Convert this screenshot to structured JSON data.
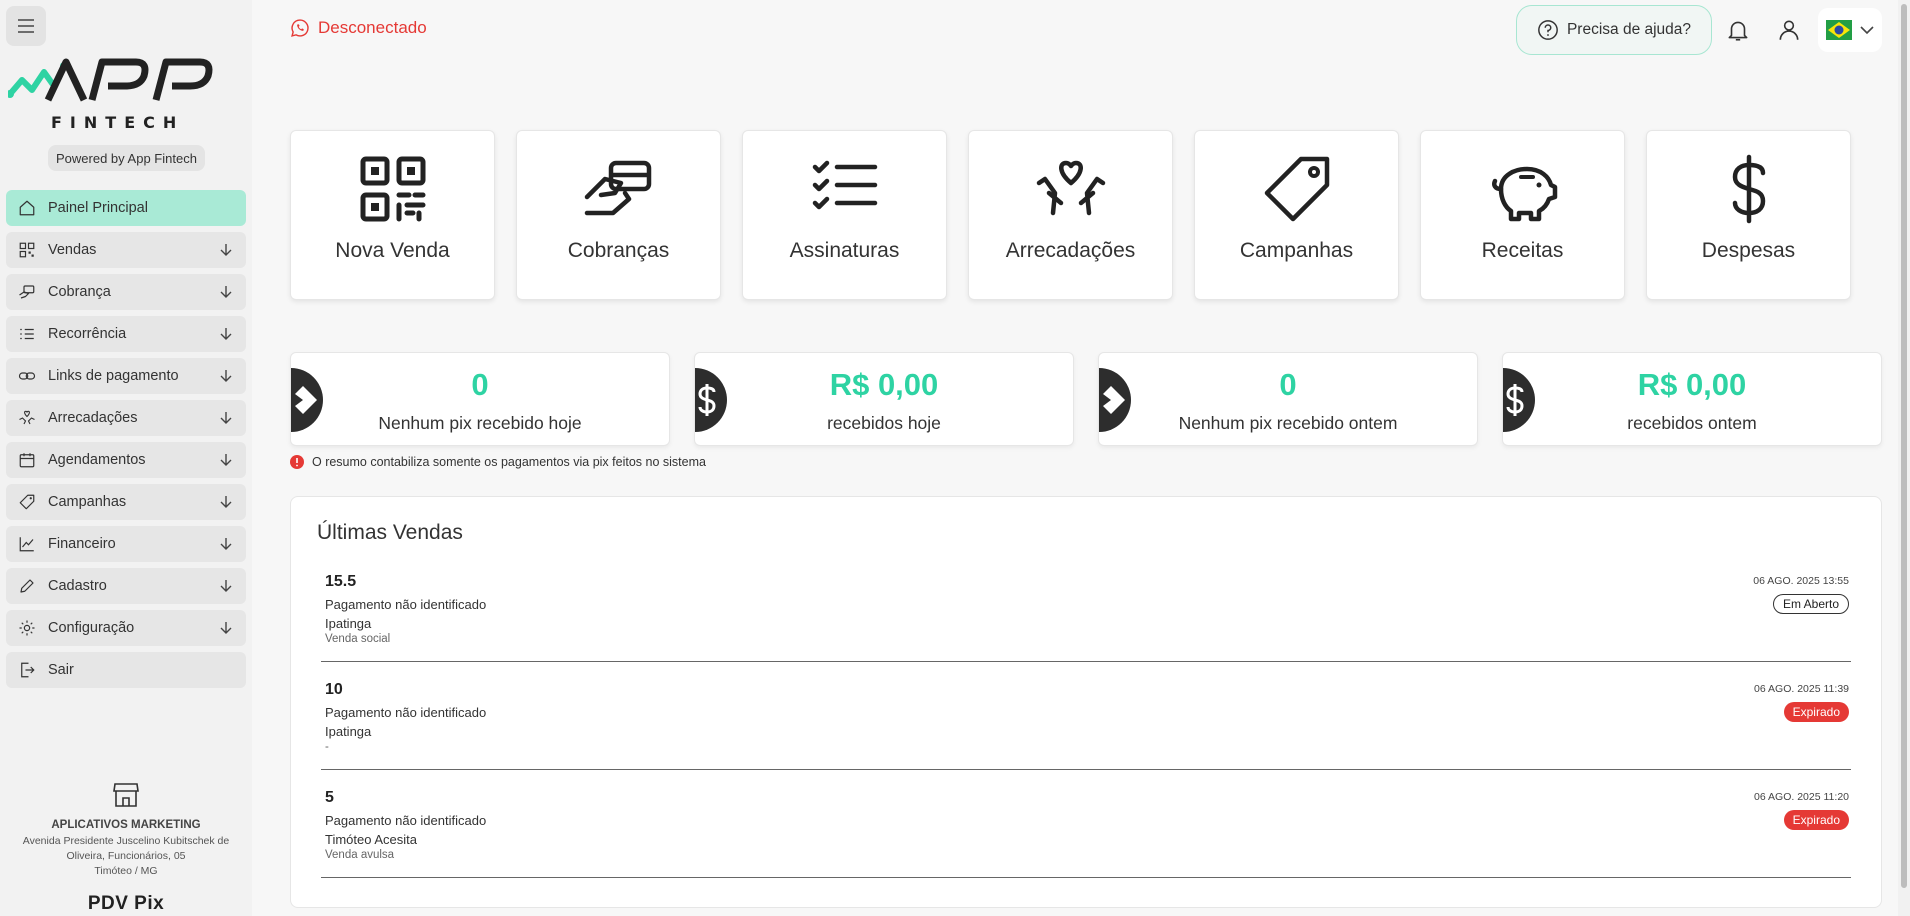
{
  "sidebar": {
    "logo_text": "FINTECH",
    "powered_by": "Powered by App Fintech",
    "items": [
      {
        "label": "Painel Principal",
        "icon": "home-icon",
        "active": true
      },
      {
        "label": "Vendas",
        "icon": "qrcode-icon"
      },
      {
        "label": "Cobrança",
        "icon": "hand-card-icon"
      },
      {
        "label": "Recorrência",
        "icon": "list-icon"
      },
      {
        "label": "Links de pagamento",
        "icon": "link-icon"
      },
      {
        "label": "Arrecadações",
        "icon": "donation-icon"
      },
      {
        "label": "Agendamentos",
        "icon": "calendar-icon"
      },
      {
        "label": "Campanhas",
        "icon": "tag-icon"
      },
      {
        "label": "Financeiro",
        "icon": "chart-icon"
      },
      {
        "label": "Cadastro",
        "icon": "pencil-icon"
      },
      {
        "label": "Configuração",
        "icon": "gear-icon"
      },
      {
        "label": "Sair",
        "icon": "logout-icon"
      }
    ],
    "store": {
      "name": "APLICATIVOS MARKETING",
      "address": "Avenida Presidente Juscelino Kubitschek de Oliveira, Funcionários, 05",
      "city": "Timóteo / MG",
      "app_name": "PDV Pix"
    }
  },
  "header": {
    "status": "Desconectado",
    "help": "Precisa de ajuda?",
    "status_color": "#e53935"
  },
  "quick_actions": [
    {
      "label": "Nova Venda",
      "icon": "qrcode-icon"
    },
    {
      "label": "Cobranças",
      "icon": "hand-card-icon"
    },
    {
      "label": "Assinaturas",
      "icon": "checklist-icon"
    },
    {
      "label": "Arrecadações",
      "icon": "donation-icon"
    },
    {
      "label": "Campanhas",
      "icon": "tag-icon"
    },
    {
      "label": "Receitas",
      "icon": "piggy-bank-icon"
    },
    {
      "label": "Despesas",
      "icon": "dollar-icon"
    }
  ],
  "stats": [
    {
      "value": "0",
      "label": "Nenhum pix recebido hoje",
      "icon": "pix-icon"
    },
    {
      "value": "R$ 0,00",
      "label": "recebidos hoje",
      "icon": "dollar-circle-icon"
    },
    {
      "value": "0",
      "label": "Nenhum pix recebido ontem",
      "icon": "pix-icon"
    },
    {
      "value": "R$ 0,00",
      "label": "recebidos ontem",
      "icon": "dollar-circle-icon"
    }
  ],
  "stats_note": "O resumo contabiliza somente os pagamentos via pix feitos no sistema",
  "sales": {
    "title": "Últimas Vendas",
    "items": [
      {
        "amount": "15.5",
        "description": "Pagamento não identificado",
        "city": "Ipatinga",
        "type": "Venda social",
        "date": "06 AGO. 2025 13:55",
        "status": "Em Aberto",
        "status_kind": "open"
      },
      {
        "amount": "10",
        "description": "Pagamento não identificado",
        "city": "Ipatinga",
        "type": "-",
        "date": "06 AGO. 2025 11:39",
        "status": "Expirado",
        "status_kind": "expired"
      },
      {
        "amount": "5",
        "description": "Pagamento não identificado",
        "city": "Timóteo Acesita",
        "type": "Venda avulsa",
        "date": "06 AGO. 2025 11:20",
        "status": "Expirado",
        "status_kind": "expired"
      }
    ]
  },
  "colors": {
    "accent": "#2ed3a3",
    "active_menu": "#a9ead6",
    "expired": "#e53935"
  }
}
